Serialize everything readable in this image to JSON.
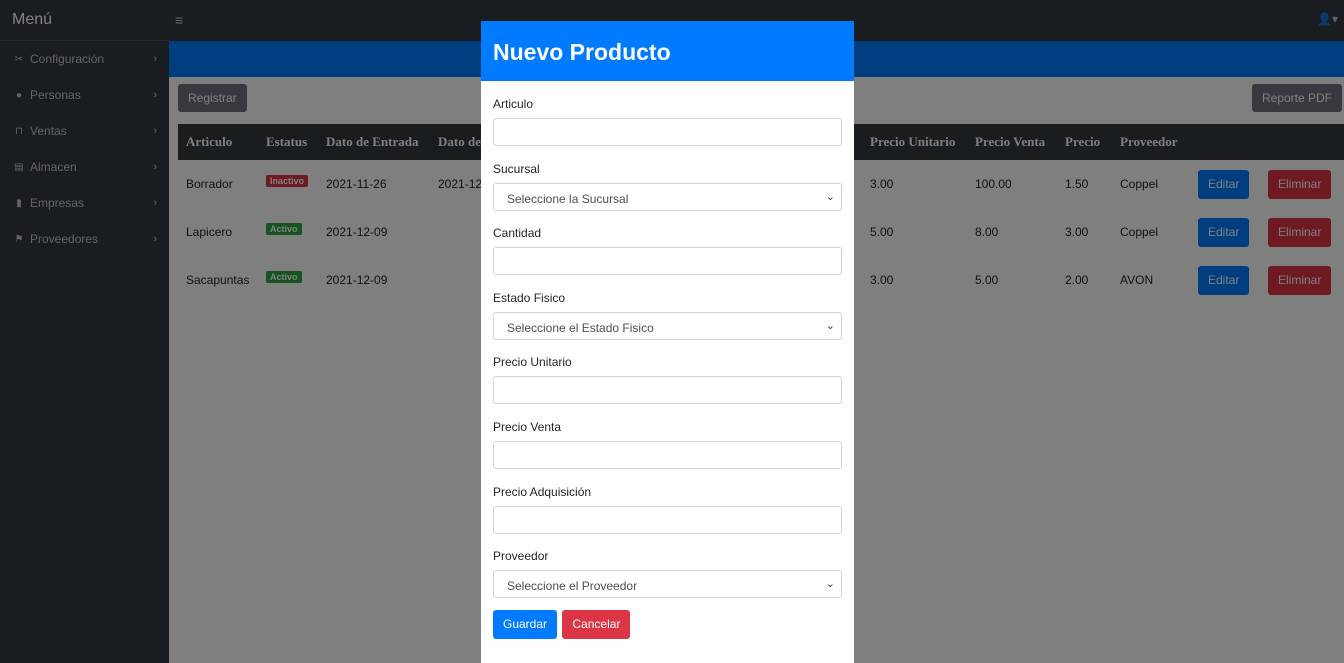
{
  "sidebar": {
    "title": "Menú",
    "items": [
      {
        "label": "Configuración",
        "icon": "tools-icon"
      },
      {
        "label": "Personas",
        "icon": "users-icon"
      },
      {
        "label": "Ventas",
        "icon": "cart-icon"
      },
      {
        "label": "Almacen",
        "icon": "warehouse-icon"
      },
      {
        "label": "Empresas",
        "icon": "building-icon"
      },
      {
        "label": "Proveedores",
        "icon": "truck-icon"
      }
    ]
  },
  "toolbar": {
    "registrar_label": "Registrar",
    "reporte_label": "Reporte PDF"
  },
  "table": {
    "headers": [
      "Articulo",
      "Estatus",
      "Dato de Entrada",
      "Dato de",
      "Precio Unitario",
      "Precio Venta",
      "Precio",
      "Proveedor"
    ],
    "rows": [
      {
        "articulo": "Borrador",
        "estatus": "Inactivo",
        "entrada": "2021-11-26",
        "dato": "2021-12",
        "unitario": "3.00",
        "venta": "100.00",
        "precio": "1.50",
        "proveedor": "Coppel"
      },
      {
        "articulo": "Lapicero",
        "estatus": "Activo",
        "entrada": "2021-12-09",
        "dato": "",
        "unitario": "5.00",
        "venta": "8.00",
        "precio": "3.00",
        "proveedor": "Coppel"
      },
      {
        "articulo": "Sacapuntas",
        "estatus": "Activo",
        "entrada": "2021-12-09",
        "dato": "",
        "unitario": "3.00",
        "venta": "5.00",
        "precio": "2.00",
        "proveedor": "AVON"
      }
    ],
    "edit_label": "Editar",
    "delete_label": "Eliminar"
  },
  "modal": {
    "title": "Nuevo Producto",
    "fields": [
      {
        "label": "Articulo",
        "type": "input",
        "value": ""
      },
      {
        "label": "Sucursal",
        "type": "select",
        "value": "Seleccione la Sucursal"
      },
      {
        "label": "Cantidad",
        "type": "input",
        "value": ""
      },
      {
        "label": "Estado Fisico",
        "type": "select",
        "value": "Seleccione el Estado Fisico"
      },
      {
        "label": "Precio Unitario",
        "type": "input",
        "value": ""
      },
      {
        "label": "Precio Venta",
        "type": "input",
        "value": ""
      },
      {
        "label": "Precio Adquisición",
        "type": "input",
        "value": ""
      },
      {
        "label": "Proveedor",
        "type": "select",
        "value": "Seleccione el Proveedor"
      }
    ],
    "save_label": "Guardar",
    "cancel_label": "Cancelar"
  },
  "colors": {
    "primary": "#007bff",
    "danger": "#dc3545",
    "success": "#28a745",
    "dark": "#343a40"
  }
}
